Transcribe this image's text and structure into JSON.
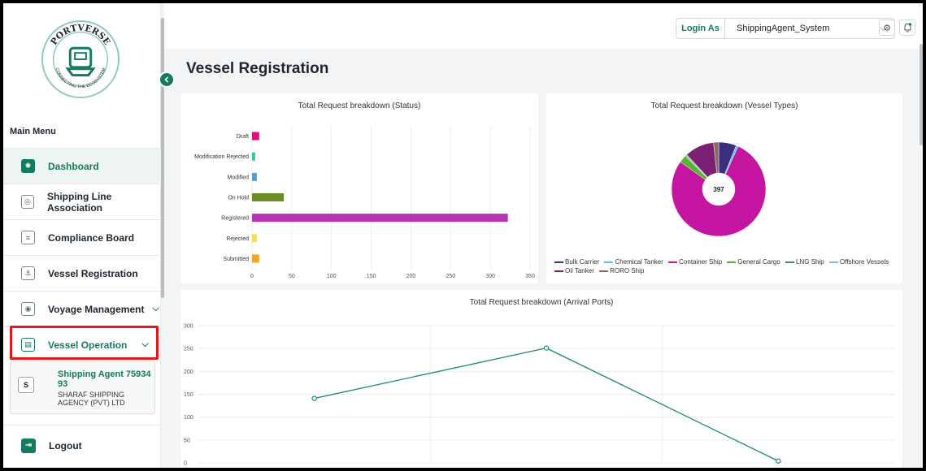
{
  "app": {
    "logo_text": "PORTVERSE",
    "logo_tagline": "CONNECTING THE ECOSYSTEM"
  },
  "sidebar": {
    "menu_heading": "Main Menu",
    "items": [
      {
        "label": "Dashboard",
        "icon": "dashboard-icon",
        "active": true
      },
      {
        "label": "Shipping Line Association",
        "icon": "association-icon"
      },
      {
        "label": "Compliance Board",
        "icon": "compliance-icon"
      },
      {
        "label": "Vessel Registration",
        "icon": "vessel-icon"
      },
      {
        "label": "Voyage Management",
        "icon": "voyage-icon",
        "has_dropdown": true
      },
      {
        "label": "Vessel Operation",
        "icon": "operation-icon",
        "has_dropdown": true,
        "highlighted": true
      }
    ],
    "agent": {
      "avatar": "S",
      "name": "Shipping Agent 7593493",
      "company": "SHARAF SHIPPING AGENCY (PVT) LTD"
    },
    "logout_label": "Logout"
  },
  "topbar": {
    "login_as_label": "Login As",
    "login_as_value": "ShippingAgent_System",
    "icons": [
      "settings-icon",
      "notification-bell-icon"
    ]
  },
  "page": {
    "title": "Vessel Registration"
  },
  "colors": {
    "brand": "#157a62",
    "highlight": "#e1191b"
  },
  "chart_data": [
    {
      "type": "bar",
      "orientation": "horizontal",
      "title": "Total Request breakdown (Status)",
      "categories": [
        "Draft",
        "Modification Rejected",
        "Modified",
        "On Hold",
        "Registered",
        "Rejected",
        "Submitted"
      ],
      "values": [
        9,
        4,
        6,
        40,
        322,
        6,
        9
      ],
      "colors": [
        "#e0107a",
        "#2ecc8f",
        "#5a9bd5",
        "#6b8e23",
        "#b532b0",
        "#f1e34a",
        "#f5a623"
      ],
      "xlim": [
        0,
        350
      ],
      "xticks": [
        0,
        50,
        100,
        150,
        200,
        250,
        300,
        350
      ]
    },
    {
      "type": "pie",
      "donut": true,
      "title": "Total Request breakdown (Vessel Types)",
      "center_label": "397",
      "labels": [
        "Bulk Carrier",
        "Chemical Tanker",
        "Container Ship",
        "General Cargo",
        "LNG Ship",
        "Offshore Vessels",
        "Oil Tanker",
        "RORO Ship"
      ],
      "values": [
        24,
        3,
        310,
        10,
        1,
        2,
        40,
        7
      ],
      "colors": [
        "#3b2e7e",
        "#4fc3e8",
        "#c3159f",
        "#55b52b",
        "#3a8a5c",
        "#8fb3d9",
        "#7a1f74",
        "#8a6a5a"
      ],
      "legend_position": "bottom"
    },
    {
      "type": "line",
      "title": "Total Request breakdown (Arrival Ports)",
      "categories": [
        "",
        "",
        ""
      ],
      "values": [
        141,
        251,
        4
      ],
      "color": "#1f8a7a",
      "ylim": [
        0,
        300
      ],
      "yticks": [
        0,
        50,
        100,
        150,
        200,
        250,
        300
      ]
    }
  ]
}
